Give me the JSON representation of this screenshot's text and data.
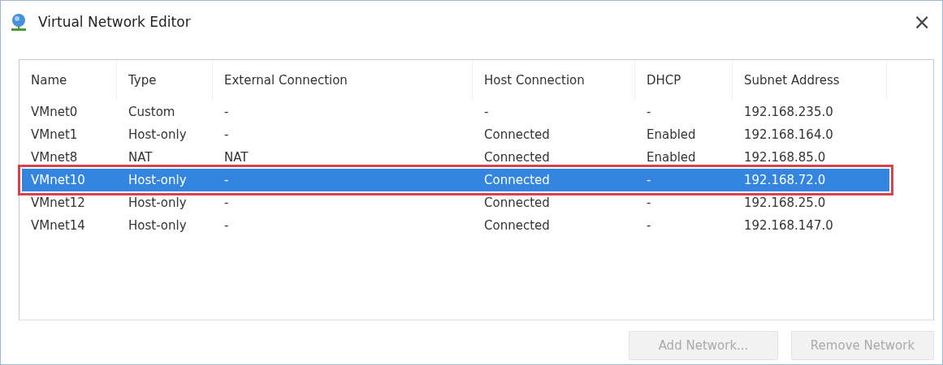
{
  "window": {
    "title": "Virtual Network Editor",
    "close": "×"
  },
  "table": {
    "columns": [
      "Name",
      "Type",
      "External Connection",
      "Host Connection",
      "DHCP",
      "Subnet Address"
    ],
    "rows": [
      {
        "cells": [
          "VMnet0",
          "Custom",
          "-",
          "-",
          "-",
          "192.168.235.0"
        ],
        "selected": false,
        "highlighted": false
      },
      {
        "cells": [
          "VMnet1",
          "Host-only",
          "-",
          "Connected",
          "Enabled",
          "192.168.164.0"
        ],
        "selected": false,
        "highlighted": false
      },
      {
        "cells": [
          "VMnet8",
          "NAT",
          "NAT",
          "Connected",
          "Enabled",
          "192.168.85.0"
        ],
        "selected": false,
        "highlighted": false
      },
      {
        "cells": [
          "VMnet10",
          "Host-only",
          "-",
          "Connected",
          "-",
          "192.168.72.0"
        ],
        "selected": true,
        "highlighted": true
      },
      {
        "cells": [
          "VMnet12",
          "Host-only",
          "-",
          "Connected",
          "-",
          "192.168.25.0"
        ],
        "selected": false,
        "highlighted": false
      },
      {
        "cells": [
          "VMnet14",
          "Host-only",
          "-",
          "Connected",
          "-",
          "192.168.147.0"
        ],
        "selected": false,
        "highlighted": false
      }
    ]
  },
  "buttons": [
    {
      "label": "Add Network...",
      "disabled": true
    },
    {
      "label": "Remove Network",
      "disabled": true
    }
  ]
}
